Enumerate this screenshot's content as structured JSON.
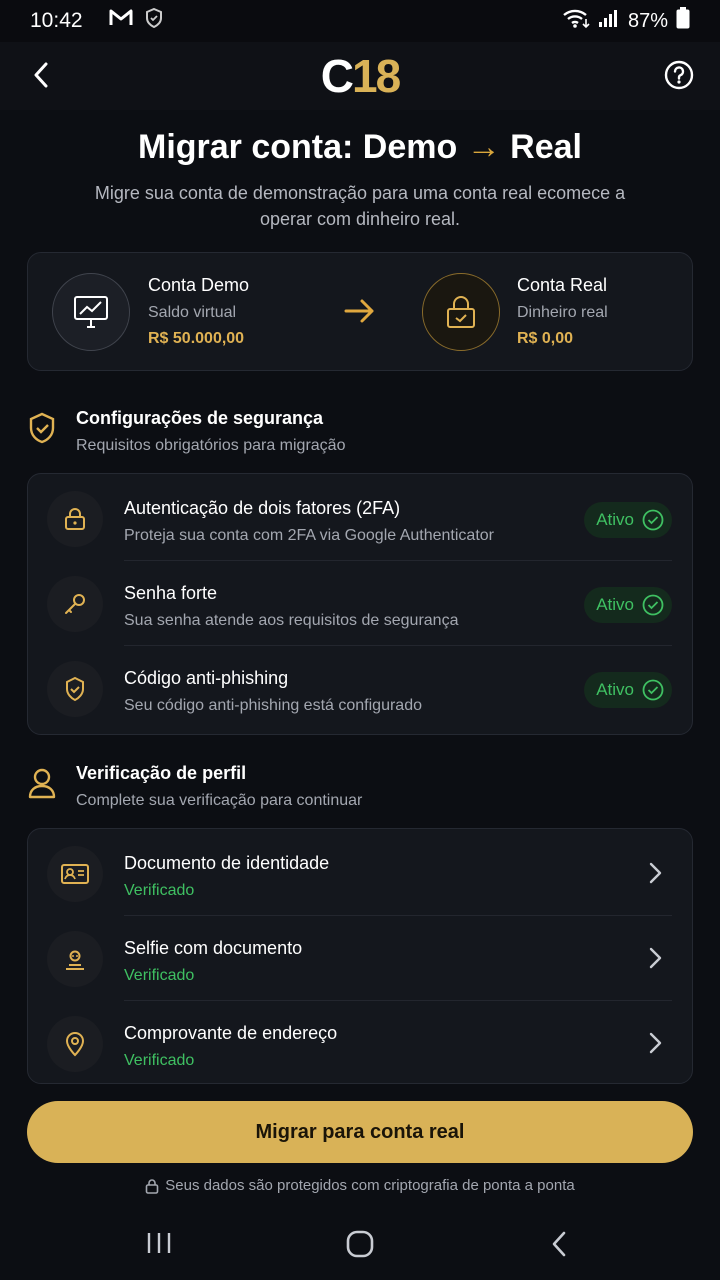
{
  "status": {
    "time": "10:42",
    "battery": "87%"
  },
  "appbar": {
    "logo_c": "C",
    "logo_num": "18"
  },
  "header": {
    "title_a": "Migrar conta: Demo",
    "title_arrow": "→",
    "title_b": "Real",
    "subtitle": "Migre sua conta de demonstração para uma conta real ecomece a operar com dinheiro real."
  },
  "accounts": {
    "demo": {
      "title": "Conta Demo",
      "sub": "Saldo virtual",
      "value": "R$ 50.000,00"
    },
    "real": {
      "title": "Conta Real",
      "sub": "Dinheiro real",
      "value": "R$ 0,00"
    }
  },
  "security": {
    "title": "Configurações de segurança",
    "subtitle": "Requisitos obrigatórios para migração",
    "items": [
      {
        "title": "Autenticação de dois fatores (2FA)",
        "desc": "Proteja sua conta com 2FA via Google Authenticator",
        "status": "Ativo",
        "icon": "lock-icon"
      },
      {
        "title": "Senha forte",
        "desc": "Sua senha atende aos requisitos de segurança",
        "status": "Ativo",
        "icon": "key-icon"
      },
      {
        "title": "Código anti-phishing",
        "desc": "Seu código anti-phishing está configurado",
        "status": "Ativo",
        "icon": "shield-check-icon"
      }
    ]
  },
  "profile": {
    "title": "Verificação de perfil",
    "subtitle": "Complete sua verificação para continuar",
    "items": [
      {
        "title": "Documento de identidade",
        "status": "Verificado",
        "icon": "id-card-icon"
      },
      {
        "title": "Selfie com documento",
        "status": "Verificado",
        "icon": "selfie-icon"
      },
      {
        "title": "Comprovante de endereço",
        "status": "Verificado",
        "icon": "location-pin-icon"
      }
    ]
  },
  "cta": {
    "label": "Migrar para conta real"
  },
  "footer": {
    "secure_note": "Seus dados são protegidos com criptografia de ponta a ponta"
  },
  "colors": {
    "accent": "#d9b257",
    "success": "#3fc062",
    "background": "#0c0e13",
    "card": "#14171d"
  }
}
